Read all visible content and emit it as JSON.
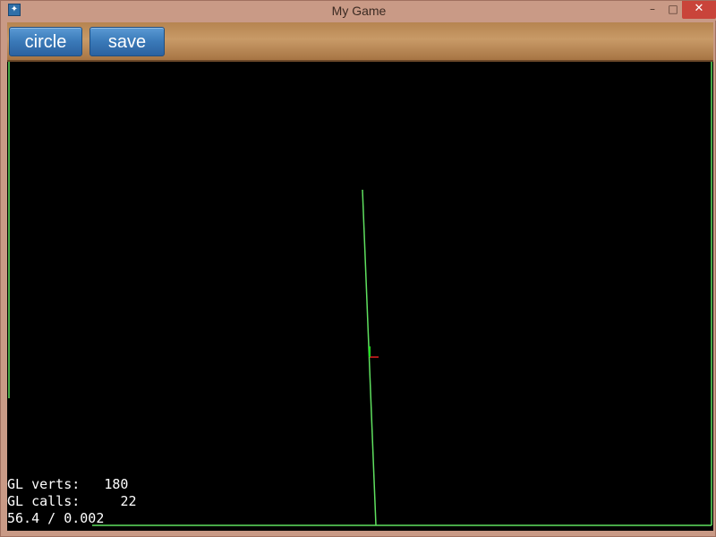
{
  "window": {
    "title": "My Game",
    "icon": "app-icon",
    "controls": {
      "minimize": "–",
      "maximize": "□",
      "close": "✕"
    }
  },
  "toolbar": {
    "circle_label": "circle",
    "save_label": "save"
  },
  "stats": {
    "verts_label": "GL verts:",
    "verts_value": "180",
    "calls_label": "GL calls:",
    "calls_value": "22",
    "fps_line": "56.4 / 0.002"
  },
  "colors": {
    "debug_line": "#5fe05f",
    "axis_x": "#e02020",
    "axis_y": "#20e020",
    "button": "#3a79b8",
    "toolbar": "#c89a67"
  }
}
